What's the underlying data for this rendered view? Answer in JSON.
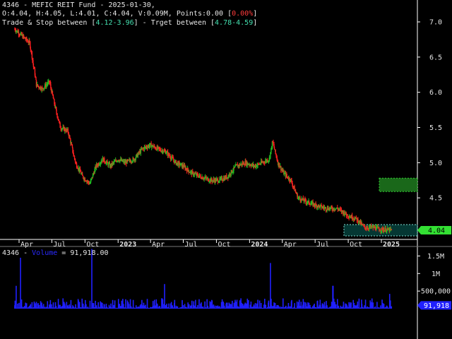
{
  "header": {
    "line1_prefix": "4346 - MEFIC REIT Fund - 2025-01-30,",
    "line2_ohlc": "O:4.04, H:4.05, L:4.01, C:4.04, V:0.09M, Points:0.00 [",
    "line2_pct": "0.00%",
    "line2_close": "]",
    "line3_a": "Trade & Stop between [",
    "line3_range1": "4.12-3.96",
    "line3_b": "] - Trget between [",
    "line3_range2": "4.78-4.59",
    "line3_c": "]"
  },
  "volume_header": {
    "symbol": "4346 - ",
    "label": "Volume",
    "value": " = 91,918.00"
  },
  "price_tag": "4.04",
  "volume_tag": "91,918",
  "colors": {
    "up": "#22c222",
    "down": "#ff2020",
    "volume": "#2020ff",
    "axis": "#ffffff",
    "zone": "#0a7a72",
    "target": "#1e7a1e"
  },
  "chart_data": [
    {
      "type": "line",
      "title": "4346 - MEFIC REIT Fund",
      "x_tick_labels": [
        "Apr",
        "Jul",
        "Oct",
        "2023",
        "Apr",
        "Jul",
        "Oct",
        "2024",
        "Apr",
        "Jul",
        "Oct",
        "2025"
      ],
      "y_tick_labels": [
        "7.0",
        "6.5",
        "6.0",
        "5.5",
        "5.0",
        "4.5"
      ],
      "ylim": [
        4.0,
        7.0
      ],
      "series": [
        {
          "x": [
            "2022-03-20",
            "2022-04-10",
            "2022-05-01",
            "2022-05-20",
            "2022-06-05",
            "2022-06-25",
            "2022-07-10",
            "2022-07-25",
            "2022-08-15",
            "2022-09-05",
            "2022-09-25",
            "2022-10-15",
            "2022-11-01",
            "2022-11-20",
            "2022-12-10",
            "2023-01-01",
            "2023-01-20",
            "2023-02-15",
            "2023-03-10",
            "2023-04-01",
            "2023-04-20",
            "2023-05-15",
            "2023-06-10",
            "2023-07-01",
            "2023-07-25",
            "2023-08-20",
            "2023-09-15",
            "2023-10-10",
            "2023-11-01",
            "2023-11-25",
            "2023-12-20",
            "2024-01-15",
            "2024-02-05",
            "2024-02-25",
            "2024-03-05",
            "2024-03-20",
            "2024-04-05",
            "2024-04-25",
            "2024-05-15",
            "2024-06-05",
            "2024-07-01",
            "2024-08-01",
            "2024-09-01",
            "2024-10-01",
            "2024-10-25",
            "2024-11-15",
            "2024-12-10",
            "2025-01-01",
            "2025-01-30"
          ],
          "values": [
            6.9,
            6.8,
            6.7,
            6.1,
            6.05,
            6.15,
            5.8,
            5.5,
            5.45,
            5.0,
            4.8,
            4.7,
            4.95,
            5.05,
            4.95,
            5.05,
            5.0,
            5.05,
            5.2,
            5.25,
            5.2,
            5.15,
            5.0,
            4.95,
            4.85,
            4.8,
            4.75,
            4.75,
            4.8,
            4.95,
            5.0,
            4.95,
            5.0,
            5.05,
            5.3,
            5.0,
            4.85,
            4.75,
            4.5,
            4.45,
            4.4,
            4.35,
            4.35,
            4.25,
            4.2,
            4.08,
            4.08,
            4.05,
            4.04
          ]
        }
      ],
      "zones": [
        {
          "label": "Trade & Stop",
          "low": 3.96,
          "high": 4.12
        },
        {
          "label": "Target",
          "low": 4.59,
          "high": 4.78
        }
      ]
    },
    {
      "type": "bar",
      "title": "Volume",
      "y_tick_labels": [
        "1.5M",
        "1M",
        "500,000"
      ],
      "ylim": [
        0,
        1750000
      ],
      "last_value": 91918
    }
  ]
}
